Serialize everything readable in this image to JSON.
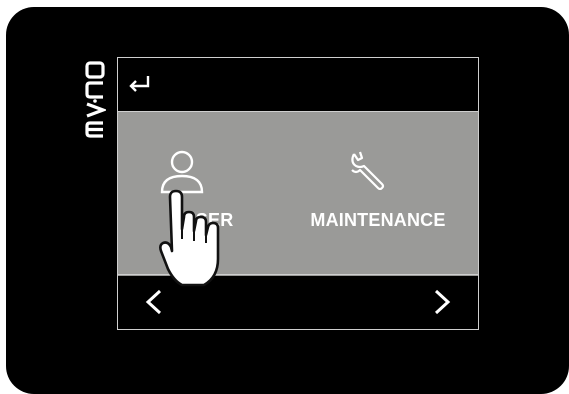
{
  "brand": {
    "logo_text": "EVCO"
  },
  "screen": {
    "back_icon": "return-arrow-icon",
    "menu": [
      {
        "label": "USER",
        "icon": "user-icon"
      },
      {
        "label": "MAINTENANCE",
        "icon": "wrench-icon"
      }
    ],
    "nav": {
      "prev_icon": "chevron-left-icon",
      "next_icon": "chevron-right-icon"
    }
  },
  "colors": {
    "device": "#000000",
    "menu_background": "#9a9a98",
    "text": "#ffffff",
    "border": "#cfcfcf"
  }
}
